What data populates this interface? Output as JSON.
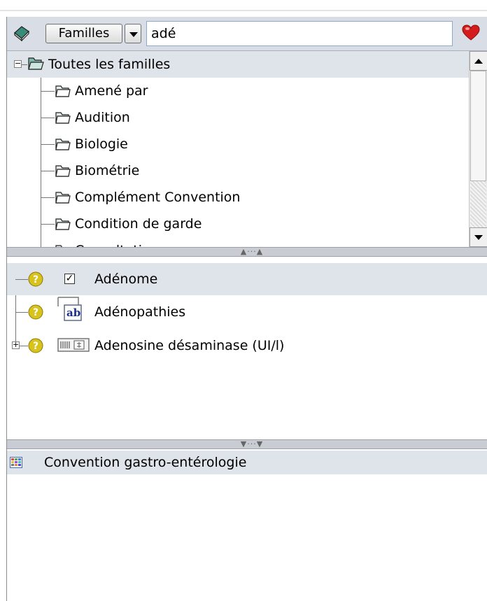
{
  "toolbar": {
    "selector_label": "Familles",
    "search_value": "adé"
  },
  "families_tree": {
    "root": {
      "label": "Toutes les familles",
      "expander": "−"
    },
    "items": [
      {
        "label": "Amené par"
      },
      {
        "label": "Audition"
      },
      {
        "label": "Biologie"
      },
      {
        "label": "Biométrie"
      },
      {
        "label": "Complément Convention"
      },
      {
        "label": "Condition de garde"
      },
      {
        "label": "Consultation"
      }
    ]
  },
  "results_tree": {
    "items": [
      {
        "label": "Adénome",
        "icon": "question-icon",
        "type_icon": "checkbox-icon",
        "checked": "✓"
      },
      {
        "label": "Adénopathies",
        "icon": "question-icon",
        "type_icon": "ab-text-icon",
        "ab": "ab"
      },
      {
        "label": "Adenosine désaminase (UI/l)",
        "icon": "question-icon",
        "type_icon": "numeric-field-icon",
        "expander": "+"
      }
    ]
  },
  "lower_list": {
    "items": [
      {
        "label": "Convention gastro-entérologie",
        "icon": "grid-icon"
      }
    ]
  },
  "colors": {
    "toolbar_bg": "#d8dde6",
    "selected_row_bg": "#dfe3ea",
    "splitter_bg": "#c9ccd3",
    "question_yellow": "#d8c21c",
    "heart_red": "#d41c1c"
  }
}
